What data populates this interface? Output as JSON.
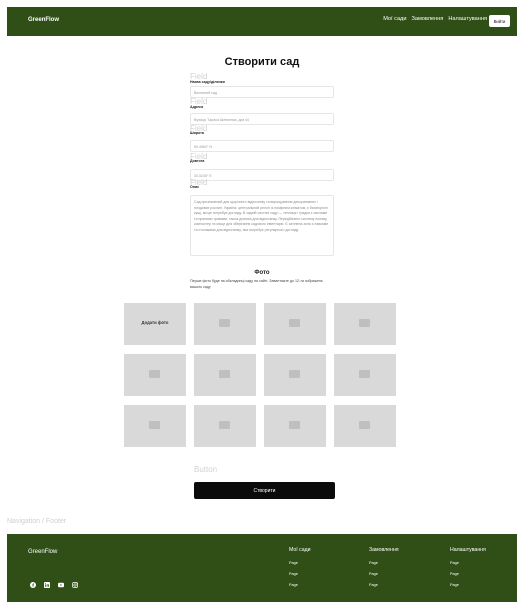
{
  "header": {
    "brand": "GreenFlow",
    "nav": [
      "Мої сади",
      "Замовлення",
      "Налаштування"
    ],
    "login": "Вийти"
  },
  "page_title": "Створити сад",
  "ghost_labels": {
    "field": "Field",
    "button": "Button",
    "footer": "Navigation / Footer"
  },
  "form": {
    "name_label": "Назва саду/ділянки",
    "name_value": "Весняний сад",
    "address_label": "Адреса",
    "address_value": "Вулиця Тараса Шевченка, дім 44",
    "lat_label": "Широта",
    "lat_value": "50.4564° N",
    "lng_label": "Довгота",
    "lng_value": "30.5245° E",
    "desc_label": "Опис",
    "desc_value": "Сад призначений для щорічного відпочинку та вирощування декоративних і плодових рослин. Україна: центральний регіон із помірним кліматом, є багаторічні кущі, місце потребує догляду. В задній частині саду — теплиця і грядки з овочами та пряними травами, також ділянка для відпочинку. Передбачено систему поливу, компостер та місце для зберігання садового інвентарю. Є затінена зона з лавками та столиками для відпочинку, яка потребує регулярного догляду."
  },
  "photos": {
    "title": "Фото",
    "description": "Перше фото буде на обкладинці саду на сайті. Завантажте до 12-ти зображень вашого саду",
    "add_label": "Додати фото"
  },
  "create_button": "Створити",
  "footer": {
    "brand": "GreenFlow",
    "columns": [
      {
        "title": "Мої сади",
        "links": [
          "Page",
          "Page",
          "Page"
        ]
      },
      {
        "title": "Замовлення",
        "links": [
          "Page",
          "Page",
          "Page"
        ]
      },
      {
        "title": "Налаштування",
        "links": [
          "Page",
          "Page",
          "Page"
        ]
      }
    ],
    "social_icons": [
      "facebook-icon",
      "linkedin-icon",
      "youtube-icon",
      "instagram-icon"
    ]
  },
  "colors": {
    "brand_green": "#2f4f16",
    "button_black": "#0b0b0b",
    "tile_gray": "#d9d9d9"
  }
}
